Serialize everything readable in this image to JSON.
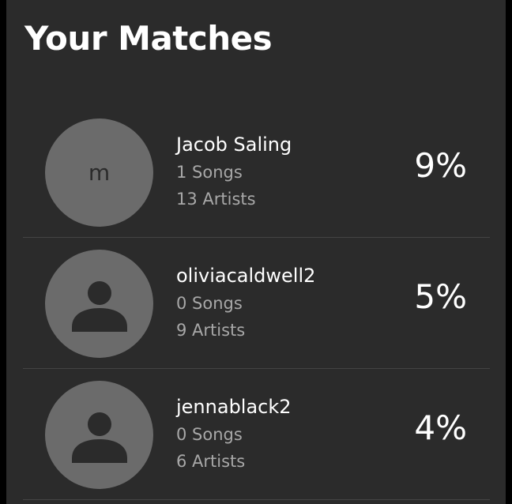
{
  "header": {
    "title": "Your Matches"
  },
  "matches": [
    {
      "name": "Jacob Saling",
      "avatar_initial": "m",
      "songs": "1 Songs",
      "artists": "13 Artists",
      "percent": "9%"
    },
    {
      "name": "oliviacaldwell2",
      "avatar_icon": "person-icon",
      "songs": "0 Songs",
      "artists": "9 Artists",
      "percent": "5%"
    },
    {
      "name": "jennablack2",
      "avatar_icon": "person-icon",
      "songs": "0 Songs",
      "artists": "6 Artists",
      "percent": "4%"
    }
  ],
  "colors": {
    "background": "#2b2b2b",
    "avatar": "#6b6b6b",
    "primary_text": "#ffffff",
    "secondary_text": "#a8a8a8",
    "divider": "#444444"
  }
}
